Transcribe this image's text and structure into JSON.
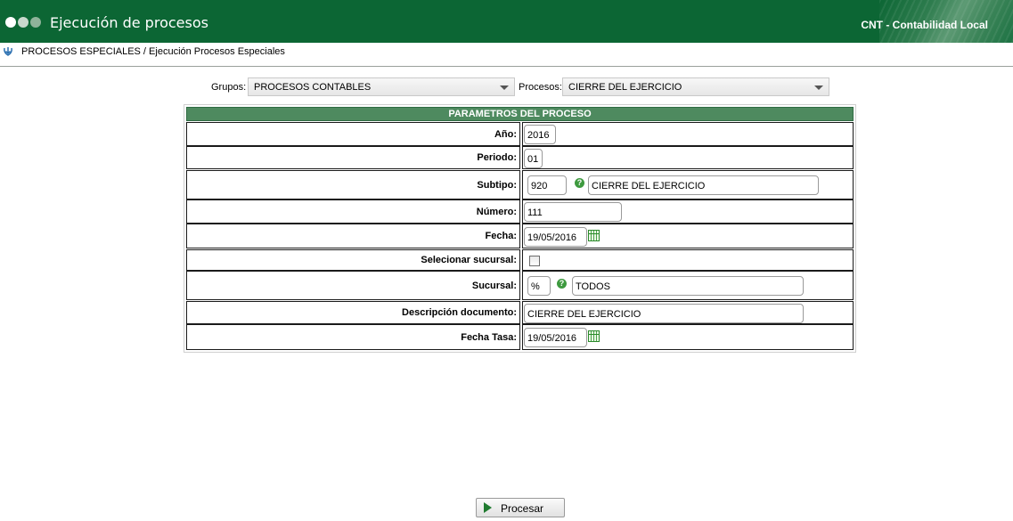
{
  "header": {
    "title": "Ejecución de procesos",
    "module": "CNT - Contabilidad Local",
    "brand_color": "#0c6634"
  },
  "breadcrumb": {
    "text": "PROCESOS ESPECIALES / Ejecución Procesos Especiales",
    "icon": "info-down-arrow-icon"
  },
  "filters": {
    "groups_label": "Grupos:",
    "groups_value": "PROCESOS CONTABLES",
    "processes_label": "Procesos:",
    "processes_value": "CIERRE DEL EJERCICIO"
  },
  "params": {
    "title": "PARAMETROS DEL PROCESO",
    "header_color": "#4e8a5f",
    "anio_label": "Año:",
    "anio_value": "2016",
    "periodo_label": "Periodo:",
    "periodo_value": "01",
    "subtipo_label": "Subtipo:",
    "subtipo_code": "920",
    "subtipo_desc": "CIERRE DEL EJERCICIO",
    "numero_label": "Número:",
    "numero_value": "111",
    "fecha_label": "Fecha:",
    "fecha_value": "19/05/2016",
    "sel_sucursal_label": "Selecionar sucursal:",
    "sel_sucursal_checked": false,
    "sucursal_label": "Sucursal:",
    "sucursal_code": "%",
    "sucursal_desc": "TODOS",
    "descripcion_label": "Descripción documento:",
    "descripcion_value": "CIERRE DEL EJERCICIO",
    "fecha_tasa_label": "Fecha Tasa:",
    "fecha_tasa_value": "19/05/2016"
  },
  "actions": {
    "process_label": "Procesar"
  }
}
